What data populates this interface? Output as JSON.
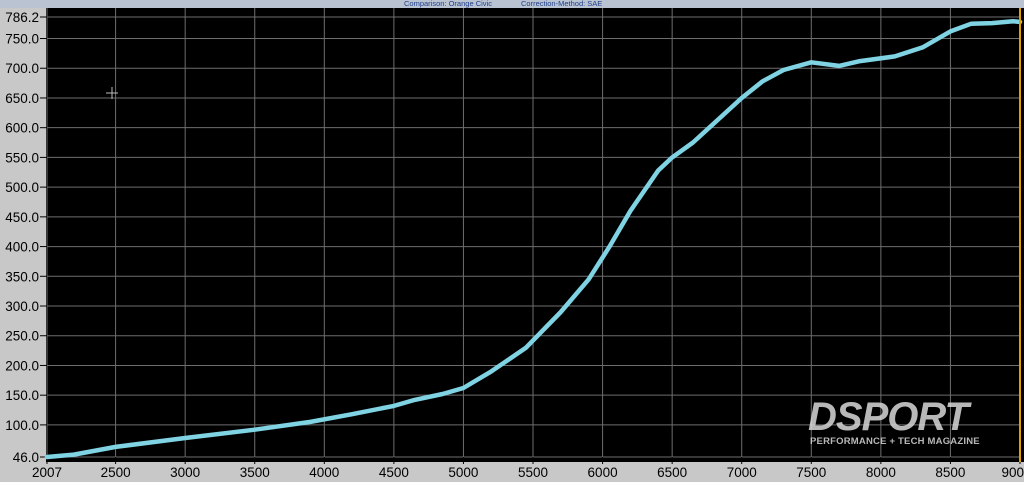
{
  "header": {
    "comparison_text": "Comparison: Orange Civic",
    "correction_text": "Correction-Method: SAE"
  },
  "watermark": {
    "brand": "DSPORT",
    "tagline": "PERFORMANCE + TECH MAGAZINE"
  },
  "colors": {
    "background": "#000000",
    "gridline": "#6e6e6e",
    "axis_strip": "#c8c8c8",
    "series": "#7fd3e3"
  },
  "chart_data": {
    "type": "line",
    "title": "",
    "xlabel": "",
    "ylabel": "",
    "xlim": [
      2007,
      9000
    ],
    "ylim": [
      46.0,
      786.2
    ],
    "grid": true,
    "x_tick_labels": [
      "2007",
      "2500",
      "3000",
      "3500",
      "4000",
      "4500",
      "5000",
      "5500",
      "6000",
      "6500",
      "7000",
      "7500",
      "8000",
      "8500",
      "900"
    ],
    "x_tick_values": [
      2007,
      2500,
      3000,
      3500,
      4000,
      4500,
      5000,
      5500,
      6000,
      6500,
      7000,
      7500,
      8000,
      8500,
      9000
    ],
    "y_tick_labels": [
      "786.2",
      "750.0",
      "700.0",
      "650.0",
      "600.0",
      "550.0",
      "500.0",
      "450.0",
      "400.0",
      "350.0",
      "300.0",
      "250.0",
      "200.0",
      "150.0",
      "100.0",
      "46.0"
    ],
    "y_tick_values": [
      786.2,
      750,
      700,
      650,
      600,
      550,
      500,
      450,
      400,
      350,
      300,
      250,
      200,
      150,
      100,
      46
    ],
    "series": [
      {
        "x": [
          2007,
          2200,
          2500,
          3000,
          3500,
          3900,
          4200,
          4500,
          4650,
          4850,
          5000,
          5200,
          5450,
          5700,
          5900,
          6050,
          6200,
          6400,
          6500,
          6650,
          6850,
          7000,
          7150,
          7300,
          7500,
          7700,
          7850,
          8100,
          8300,
          8500,
          8650,
          8800,
          8950,
          9000
        ],
        "y": [
          46,
          50,
          63,
          78,
          92,
          105,
          118,
          132,
          142,
          152,
          162,
          190,
          230,
          290,
          345,
          400,
          460,
          528,
          550,
          575,
          618,
          650,
          678,
          697,
          710,
          704,
          712,
          720,
          735,
          762,
          775,
          776,
          779,
          778
        ]
      }
    ]
  }
}
